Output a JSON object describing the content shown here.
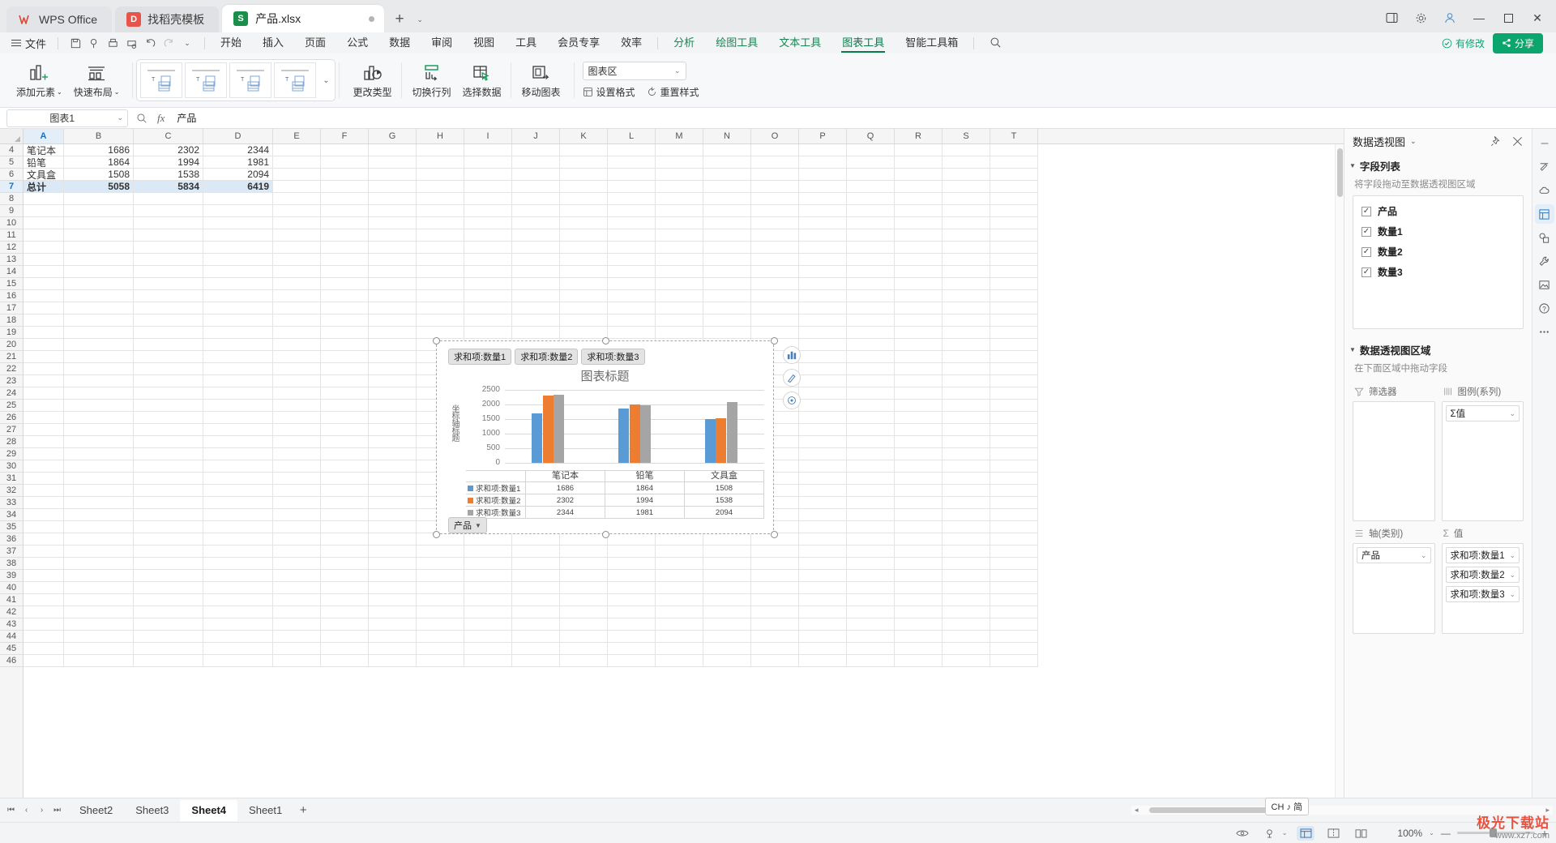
{
  "window": {
    "app_tabs": [
      {
        "label": "WPS Office",
        "icon": "wps-logo-icon"
      },
      {
        "label": "找稻壳模板",
        "icon": "docker-icon"
      }
    ],
    "document_tab": {
      "label": "产品.xlsx",
      "icon": "spreadsheet-icon",
      "modified_dot": "●"
    },
    "new_tab_label": "+",
    "controls": {
      "minimize": "—",
      "maximize": "▢",
      "close": "✕"
    }
  },
  "menubar": {
    "file_label": "文件",
    "quick_icons": [
      "save-icon",
      "print-preview-icon",
      "print-icon",
      "print-area-icon",
      "undo-icon",
      "redo-icon",
      "customize-caret-icon"
    ],
    "tabs": [
      {
        "label": "开始",
        "state": "normal"
      },
      {
        "label": "插入",
        "state": "normal"
      },
      {
        "label": "页面",
        "state": "normal"
      },
      {
        "label": "公式",
        "state": "normal"
      },
      {
        "label": "数据",
        "state": "normal"
      },
      {
        "label": "审阅",
        "state": "normal"
      },
      {
        "label": "视图",
        "state": "normal"
      },
      {
        "label": "工具",
        "state": "normal"
      },
      {
        "label": "会员专享",
        "state": "normal"
      },
      {
        "label": "效率",
        "state": "normal"
      },
      {
        "label": "分析",
        "state": "context"
      },
      {
        "label": "绘图工具",
        "state": "context"
      },
      {
        "label": "文本工具",
        "state": "context"
      },
      {
        "label": "图表工具",
        "state": "active"
      },
      {
        "label": "智能工具箱",
        "state": "normal"
      }
    ],
    "search_icon": "search-icon",
    "save_state": "有修改",
    "share_label": "分享"
  },
  "ribbon": {
    "add_element": {
      "label": "添加元素",
      "icon": "add-chart-element-icon",
      "caret": "⌄"
    },
    "quick_layout": {
      "label": "快速布局",
      "icon": "quick-layout-icon",
      "caret": "⌄"
    },
    "gallery_more": "⌄",
    "gallery_count": 4,
    "change_type": {
      "label": "更改类型",
      "icon": "change-chart-type-icon"
    },
    "switch_row_col": {
      "label": "切换行列",
      "icon": "switch-row-column-icon"
    },
    "select_data": {
      "label": "选择数据",
      "icon": "select-data-icon"
    },
    "move_chart": {
      "label": "移动图表",
      "icon": "move-chart-icon"
    },
    "chart_area_select": {
      "value": "图表区",
      "caret": "⌄"
    },
    "format_button": {
      "label": "设置格式",
      "icon": "format-icon"
    },
    "reset_style_button": {
      "label": "重置样式",
      "icon": "reset-style-icon"
    }
  },
  "formulabar": {
    "namebox_value": "图表1",
    "namebox_caret": "⌄",
    "zoom_icon": "name-zoom-icon",
    "fx_label": "fx",
    "formula_value": "产品"
  },
  "grid": {
    "columns": [
      "A",
      "B",
      "C",
      "D",
      "E",
      "F",
      "G",
      "H",
      "I",
      "J",
      "K",
      "L",
      "M",
      "N",
      "O",
      "P",
      "Q",
      "R",
      "S",
      "T"
    ],
    "highlight_column": "A",
    "row_numbers": [
      4,
      5,
      6,
      7,
      8,
      9,
      10,
      11,
      12,
      13,
      14,
      15,
      16,
      17,
      18,
      19,
      20,
      21,
      22,
      23,
      24,
      25,
      26,
      27,
      28,
      29,
      30,
      31,
      32,
      33,
      34,
      35,
      36,
      37,
      38,
      39,
      40,
      41,
      42,
      43,
      44,
      45,
      46
    ],
    "highlight_row": 7,
    "data_rows": [
      {
        "row": 4,
        "a": "笔记本",
        "b": "1686",
        "c": "2302",
        "d": "2344",
        "bold": false
      },
      {
        "row": 5,
        "a": "铅笔",
        "b": "1864",
        "c": "1994",
        "d": "1981",
        "bold": false
      },
      {
        "row": 6,
        "a": "文具盒",
        "b": "1508",
        "c": "1538",
        "d": "2094",
        "bold": false
      },
      {
        "row": 7,
        "a": "总计",
        "b": "5058",
        "c": "5834",
        "d": "6419",
        "bold": true
      }
    ]
  },
  "chart": {
    "field_buttons": [
      {
        "label": "求和项:数量1"
      },
      {
        "label": "求和项:数量2"
      },
      {
        "label": "求和项:数量3"
      }
    ],
    "axis_field_button": {
      "label": "产品",
      "caret": "▼"
    },
    "side_buttons": [
      "chart-elements-icon",
      "chart-style-icon",
      "chart-filter-icon"
    ],
    "chart_data": {
      "type": "bar",
      "title": "图表标题",
      "xlabel": "",
      "ylabel": "坐标轴标题",
      "categories": [
        "笔记本",
        "铅笔",
        "文具盒"
      ],
      "series": [
        {
          "name": "求和项:数量1",
          "color": "#5b9bd5",
          "values": [
            1686,
            1864,
            1508
          ]
        },
        {
          "name": "求和项:数量2",
          "color": "#ed7d31",
          "values": [
            2302,
            1994,
            1538
          ]
        },
        {
          "name": "求和项:数量3",
          "color": "#a5a5a5",
          "values": [
            2344,
            1981,
            2094
          ]
        }
      ],
      "ylim": [
        0,
        2500
      ],
      "yticks": [
        0,
        500,
        1000,
        1500,
        2000,
        2500
      ],
      "grid": true,
      "legend": "data-table",
      "data_table": true
    }
  },
  "pivot": {
    "title": "数据透视图",
    "title_caret": "⌄",
    "pin_icon": "pin-icon",
    "close_icon": "close-icon",
    "fieldlist_section": {
      "label": "字段列表",
      "hint": "将字段拖动至数据透视图区域"
    },
    "fields": [
      {
        "label": "产品",
        "checked": true
      },
      {
        "label": "数量1",
        "checked": true
      },
      {
        "label": "数量2",
        "checked": true
      },
      {
        "label": "数量3",
        "checked": true
      }
    ],
    "checkmark": "✓",
    "areas_section": {
      "label": "数据透视图区域",
      "hint": "在下面区域中拖动字段"
    },
    "filter_area": {
      "label": "筛选器",
      "icon": "filter-icon",
      "items": []
    },
    "legend_area": {
      "label": "图例(系列)",
      "icon": "legend-icon",
      "items": [
        {
          "label": "Σ值",
          "caret": "⌄"
        }
      ]
    },
    "axis_area": {
      "label": "轴(类别)",
      "icon": "axis-icon",
      "items": [
        {
          "label": "产品",
          "caret": "⌄"
        }
      ]
    },
    "values_area": {
      "label": "值",
      "icon": "sigma-icon",
      "items": [
        {
          "label": "求和项:数量1",
          "caret": "⌄"
        },
        {
          "label": "求和项:数量2",
          "caret": "⌄"
        },
        {
          "label": "求和项:数量3",
          "caret": "⌄"
        }
      ]
    }
  },
  "rail": {
    "buttons": [
      "minus-icon",
      "pen-tool-icon",
      "cloud-icon",
      "pivot-panel-icon",
      "shapes-icon",
      "tools-icon",
      "picture-icon",
      "help-icon",
      "more-icon"
    ]
  },
  "sheetbar": {
    "nav": [
      "first-sheet-icon",
      "prev-sheet-icon",
      "next-sheet-icon",
      "last-sheet-icon"
    ],
    "sheets": [
      {
        "label": "Sheet2",
        "active": false
      },
      {
        "label": "Sheet3",
        "active": false
      },
      {
        "label": "Sheet4",
        "active": true
      },
      {
        "label": "Sheet1",
        "active": false
      }
    ],
    "add_label": "+"
  },
  "statusbar": {
    "ime": "CH ♪ 简",
    "view_icons": [
      "eye-icon",
      "page-setup-icon",
      "normal-view-icon",
      "page-break-icon",
      "reading-view-icon"
    ],
    "zoom_value": "100%",
    "zoom_caret": "⌄",
    "zoom_minus": "—",
    "zoom_plus": "+"
  },
  "watermark": {
    "line1": "极光下载站",
    "line2": "www.xz7.com"
  }
}
